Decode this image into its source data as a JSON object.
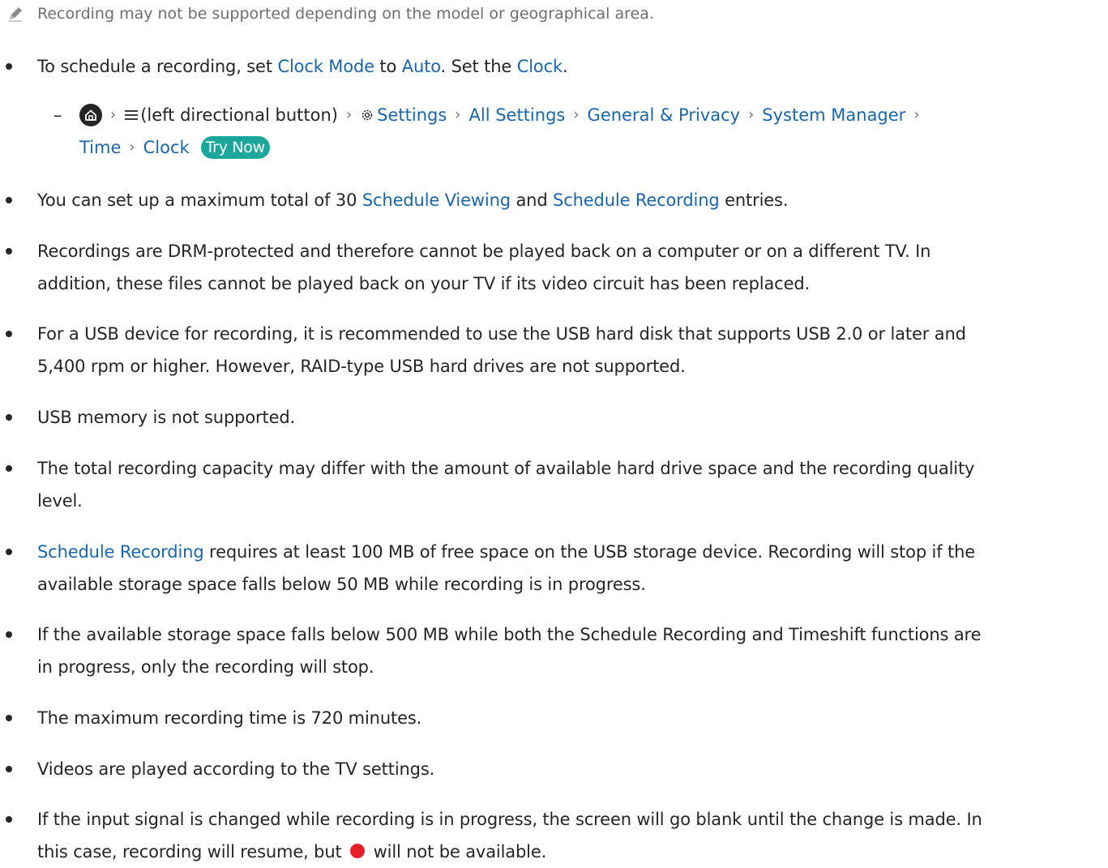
{
  "note": {
    "text": "Recording may not be supported depending on the model or geographical area.",
    "icon": "pencil-icon"
  },
  "bullets": {
    "b1": {
      "p1": "To schedule a recording, set ",
      "l1": "Clock Mode",
      "p2": " to ",
      "l2": "Auto",
      "p3": ". Set the ",
      "l3": "Clock",
      "p4": "."
    },
    "path": {
      "dash": "–",
      "home_icon": "home-icon",
      "menu_icon": "menu-icon",
      "menu_text": "(left directional button)",
      "gear_icon": "gear-icon",
      "settings": "Settings",
      "all_settings": "All Settings",
      "general_privacy": "General & Privacy",
      "system_manager": "System Manager",
      "time": "Time",
      "clock": "Clock",
      "try_now": "Try Now",
      "separator": "›"
    },
    "b2": {
      "p1": "You can set up a maximum total of 30 ",
      "l1": "Schedule Viewing",
      "p2": " and ",
      "l2": "Schedule Recording",
      "p3": " entries."
    },
    "b3": {
      "line1": "Recordings are DRM-protected and therefore cannot be played back on a computer or on a different TV. In",
      "line2": "addition, these files cannot be played back on your TV if its video circuit has been replaced."
    },
    "b4": {
      "line1": "For a USB device for recording, it is recommended to use the USB hard disk that supports USB 2.0 or later and",
      "line2": "5,400 rpm or higher. However, RAID-type USB hard drives are not supported."
    },
    "b5": {
      "line1": "USB memory is not supported."
    },
    "b6": {
      "line1": "The total recording capacity may differ with the amount of available hard drive space and the recording quality",
      "line2": "level."
    },
    "b7": {
      "l1": "Schedule Recording",
      "p1": " requires at least 100 MB of free space on the USB storage device. Recording will stop if the",
      "line2": "available storage space falls below 50 MB while recording is in progress."
    },
    "b8": {
      "line1": "If the available storage space falls below 500 MB while both the Schedule Recording and Timeshift functions are",
      "line2": "in progress, only the recording will stop."
    },
    "b9": {
      "line1": "The maximum recording time is 720 minutes."
    },
    "b10": {
      "line1": "Videos are played according to the TV settings."
    },
    "b11": {
      "line1": "If the input signal is changed while recording is in progress, the screen will go blank until the change is made. In",
      "p1": "this case, recording will resume, but ",
      "record_icon": "record-icon",
      "p2": " will not be available."
    }
  },
  "colors": {
    "link": "#1867ae",
    "text": "#252525",
    "note": "#6e6e6e",
    "try_now_bg": "#1ba79b",
    "record_dot": "#e8202a"
  }
}
